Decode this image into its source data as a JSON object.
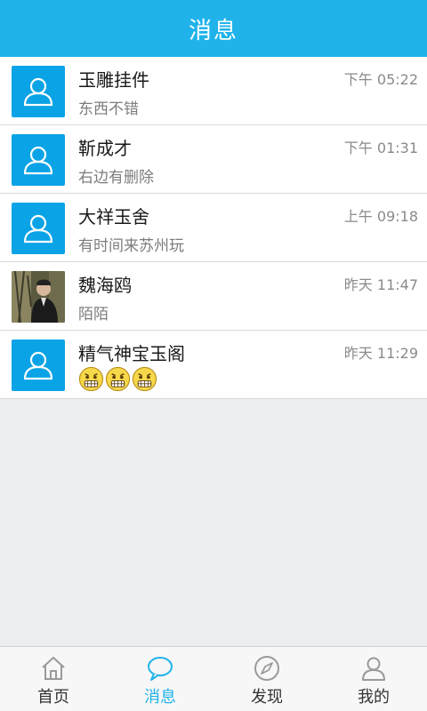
{
  "header": {
    "title": "消息"
  },
  "colors": {
    "accent": "#1fb3ea",
    "avatar_bg": "#0aa3e6"
  },
  "conversations": [
    {
      "name": "玉雕挂件",
      "preview": "东西不错",
      "time": "下午 05:22",
      "avatar": "default-user-avatar"
    },
    {
      "name": "靳成才",
      "preview": "右边有删除",
      "time": "下午 01:31",
      "avatar": "default-user-avatar"
    },
    {
      "name": "大祥玉舍",
      "preview": "有时间来苏州玩",
      "time": "上午 09:18",
      "avatar": "default-user-avatar"
    },
    {
      "name": "魏海鸥",
      "preview": "陌陌",
      "time": "昨天 11:47",
      "avatar": "photo-avatar"
    },
    {
      "name": "精气神宝玉阁",
      "preview": "",
      "time": "昨天 11:29",
      "avatar": "default-user-avatar",
      "emojis": [
        "grimace-emoji",
        "grimace-emoji",
        "grimace-emoji"
      ]
    }
  ],
  "tabbar": {
    "items": [
      {
        "label": "首页",
        "icon": "home-icon",
        "active": false
      },
      {
        "label": "消息",
        "icon": "chat-bubble-icon",
        "active": true
      },
      {
        "label": "发现",
        "icon": "compass-icon",
        "active": false
      },
      {
        "label": "我的",
        "icon": "person-icon",
        "active": false
      }
    ]
  }
}
